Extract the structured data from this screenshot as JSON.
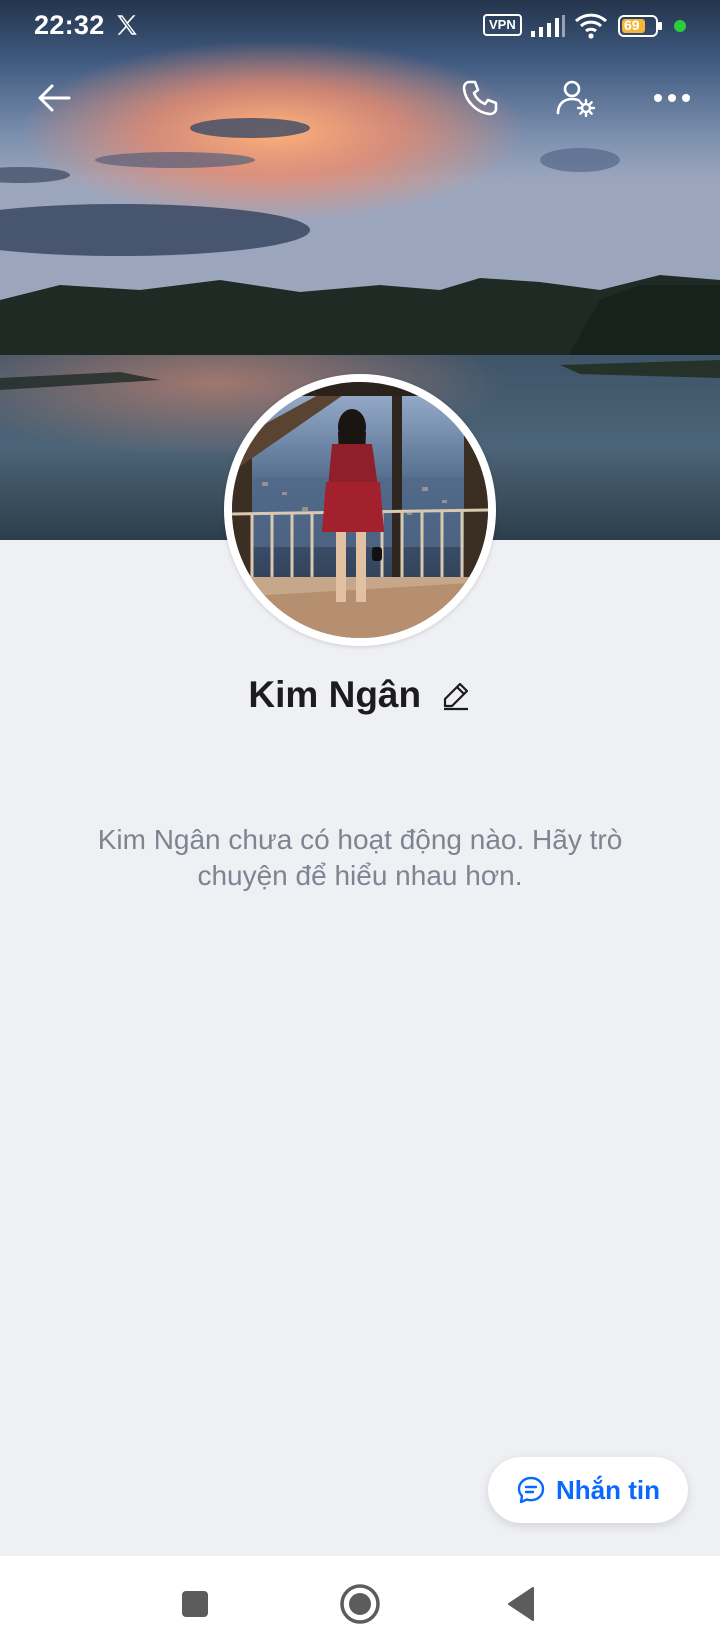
{
  "status_bar": {
    "time": "22:32",
    "vpn_label": "VPN",
    "battery_level": "69",
    "icons": [
      "x-logo-icon",
      "vpn-icon",
      "signal-icon",
      "wifi-icon",
      "battery-icon",
      "notification-dot-icon"
    ]
  },
  "top_bar": {
    "icons": [
      "back-arrow-icon",
      "phone-icon",
      "user-settings-icon",
      "more-dots-icon"
    ]
  },
  "profile": {
    "name": "Kim Ngân",
    "empty_activity_text": "Kim Ngân chưa có hoạt động nào. Hãy trò chuyện để hiểu nhau hơn."
  },
  "actions": {
    "message_label": "Nhắn tin"
  },
  "nav_bar": {
    "icons": [
      "square-recents-icon",
      "circle-home-icon",
      "triangle-back-icon"
    ]
  },
  "colors": {
    "accent": "#0a68ff",
    "background": "#eff0f4",
    "muted_text": "#7d8592"
  }
}
